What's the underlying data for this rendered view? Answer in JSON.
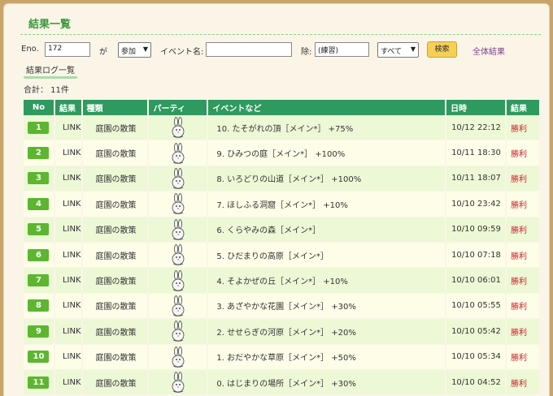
{
  "page": {
    "title": "結果一覧"
  },
  "filter": {
    "eno_label": "Eno.",
    "eno_value": "172",
    "ga_label": "が",
    "participation_value": "参加",
    "event_name_label": "イベント名:",
    "event_name_value": "",
    "exclude_label": "除:",
    "exclude_value": "(練習)",
    "scope_value": "すべて",
    "search_label": "検索",
    "all_results_label": "全体結果"
  },
  "log_link_label": "結果ログ一覧",
  "total_text": "合計： 11件",
  "table": {
    "headers": [
      "No",
      "結果",
      "種類",
      "パーティ",
      "イベントなど",
      "日時",
      "結果"
    ],
    "rows": [
      {
        "no": "1",
        "result": "LINK",
        "kind": "庭園の散策",
        "event": "10. たそがれの頂［メイン*］ +75%",
        "date": "10/12 22:12",
        "outcome": "勝利"
      },
      {
        "no": "2",
        "result": "LINK",
        "kind": "庭園の散策",
        "event": "9. ひみつの庭［メイン*］ +100%",
        "date": "10/11 18:30",
        "outcome": "勝利"
      },
      {
        "no": "3",
        "result": "LINK",
        "kind": "庭園の散策",
        "event": "8. いろどりの山道［メイン*］ +100%",
        "date": "10/11 18:07",
        "outcome": "勝利"
      },
      {
        "no": "4",
        "result": "LINK",
        "kind": "庭園の散策",
        "event": "7. ほしふる洞窟［メイン*］ +10%",
        "date": "10/10 23:42",
        "outcome": "勝利"
      },
      {
        "no": "5",
        "result": "LINK",
        "kind": "庭園の散策",
        "event": "6. くらやみの森［メイン*］",
        "date": "10/10 09:59",
        "outcome": "勝利"
      },
      {
        "no": "6",
        "result": "LINK",
        "kind": "庭園の散策",
        "event": "5. ひだまりの高原［メイン*］",
        "date": "10/10 07:18",
        "outcome": "勝利"
      },
      {
        "no": "7",
        "result": "LINK",
        "kind": "庭園の散策",
        "event": "4. そよかぜの丘［メイン*］ +10%",
        "date": "10/10 06:01",
        "outcome": "勝利"
      },
      {
        "no": "8",
        "result": "LINK",
        "kind": "庭園の散策",
        "event": "3. あざやかな花園［メイン*］ +30%",
        "date": "10/10 05:55",
        "outcome": "勝利"
      },
      {
        "no": "9",
        "result": "LINK",
        "kind": "庭園の散策",
        "event": "2. せせらぎの河原［メイン*］ +20%",
        "date": "10/10 05:42",
        "outcome": "勝利"
      },
      {
        "no": "10",
        "result": "LINK",
        "kind": "庭園の散策",
        "event": "1. おだやかな草原［メイン*］ +50%",
        "date": "10/10 05:34",
        "outcome": "勝利"
      },
      {
        "no": "11",
        "result": "LINK",
        "kind": "庭園の散策",
        "event": "0. はじまりの場所［メイン*］ +30%",
        "date": "10/10 04:52",
        "outcome": "勝利"
      }
    ]
  },
  "colors": {
    "header_green": "#2e9a5f",
    "badge_green": "#5cb630",
    "win_red": "#d0202a",
    "title_green": "#3a9a3a",
    "frame_border": "#c9a46a"
  },
  "icons": {
    "party": "rabbit-icon",
    "dropdown": "chevron-down-icon"
  }
}
